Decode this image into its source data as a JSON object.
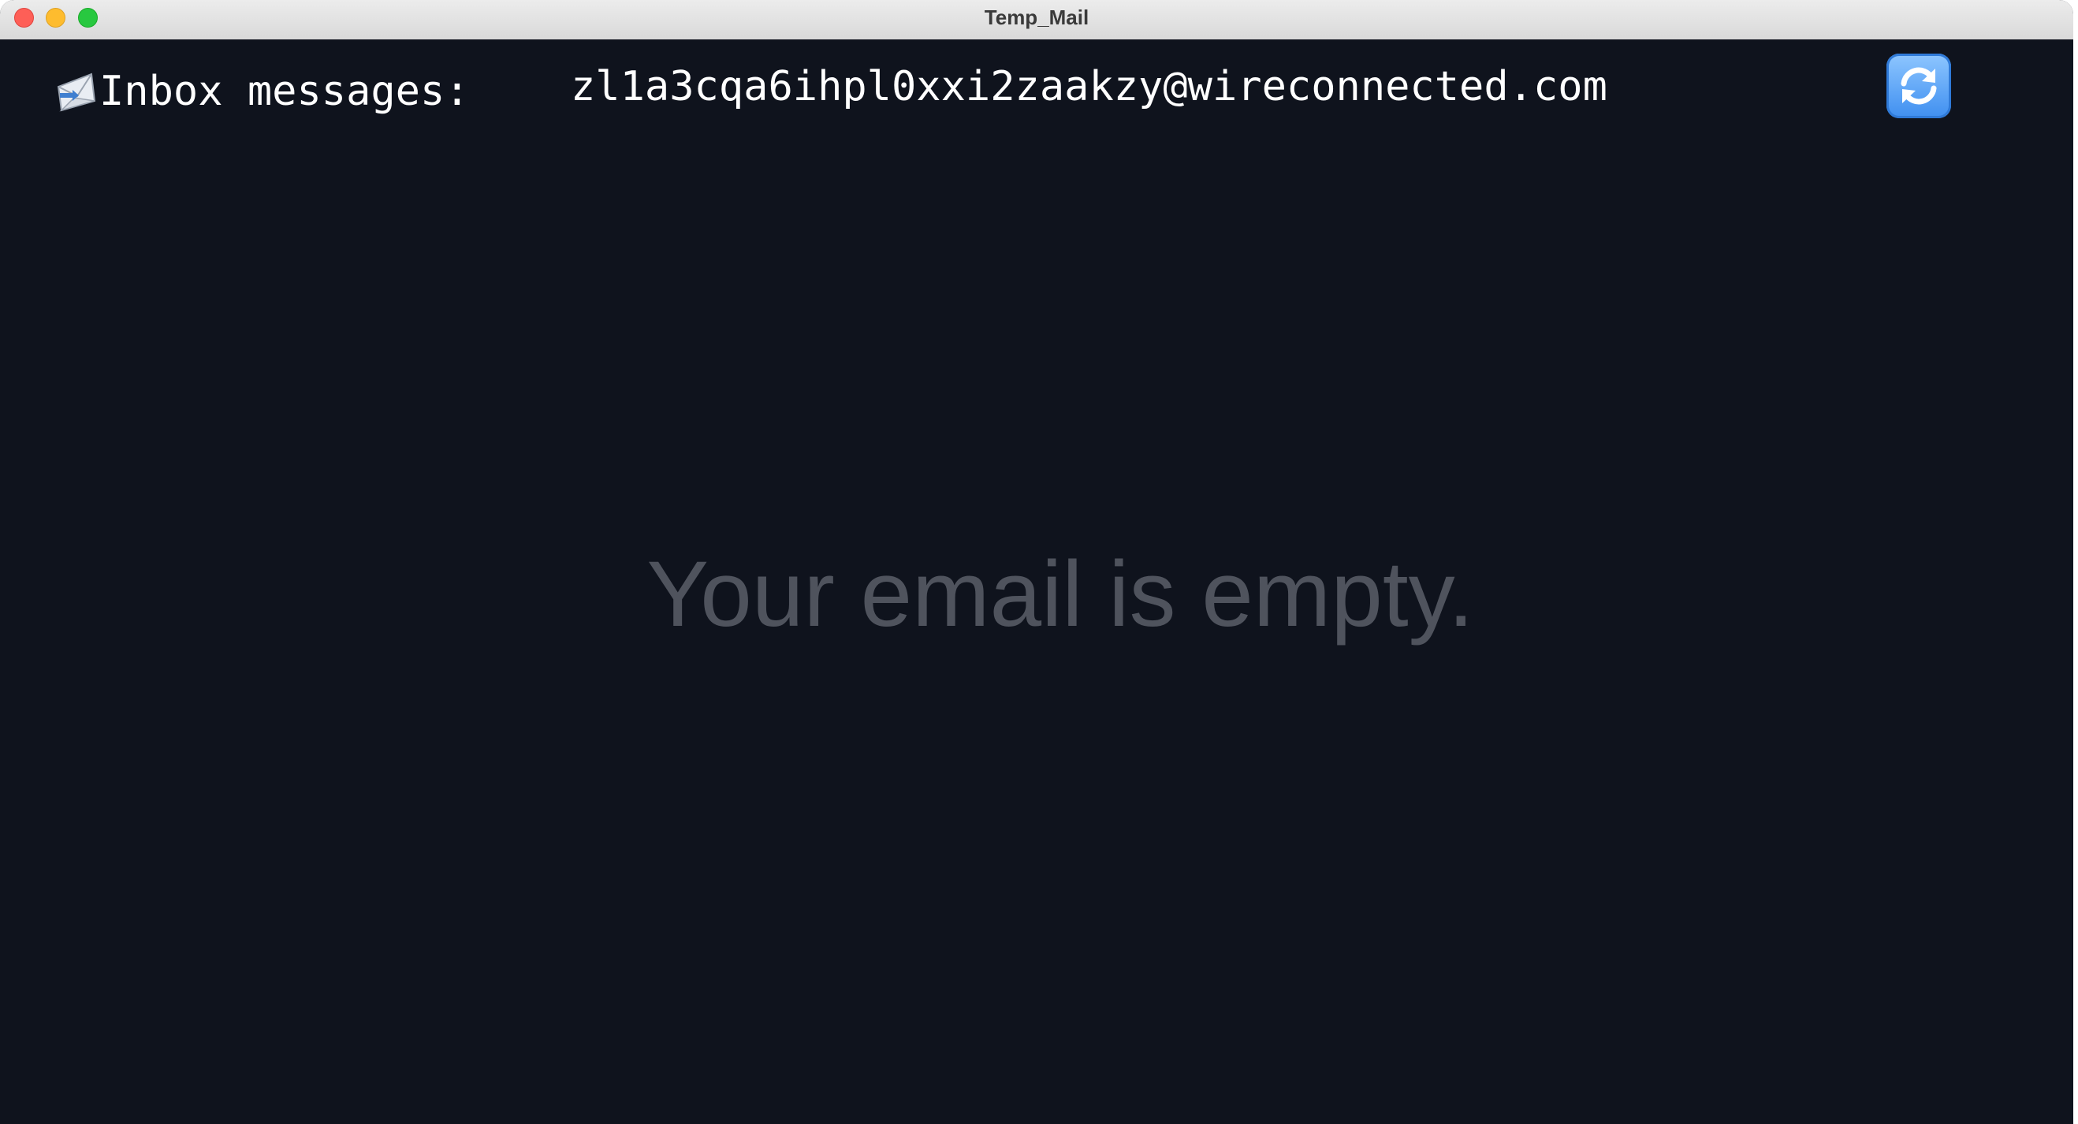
{
  "window": {
    "title": "Temp_Mail"
  },
  "header": {
    "inbox_label": "Inbox messages:",
    "inbox_icon": "incoming-envelope-icon",
    "email_address": "zl1a3cqa6ihpl0xxi2zaakzy@wireconnected.com",
    "refresh_icon": "refresh-icon"
  },
  "main": {
    "empty_message": "Your email is empty."
  },
  "colors": {
    "background": "#0f131d",
    "text": "#ffffff",
    "muted_text": "#4f535d",
    "refresh_blue": "#3f8ff0"
  }
}
